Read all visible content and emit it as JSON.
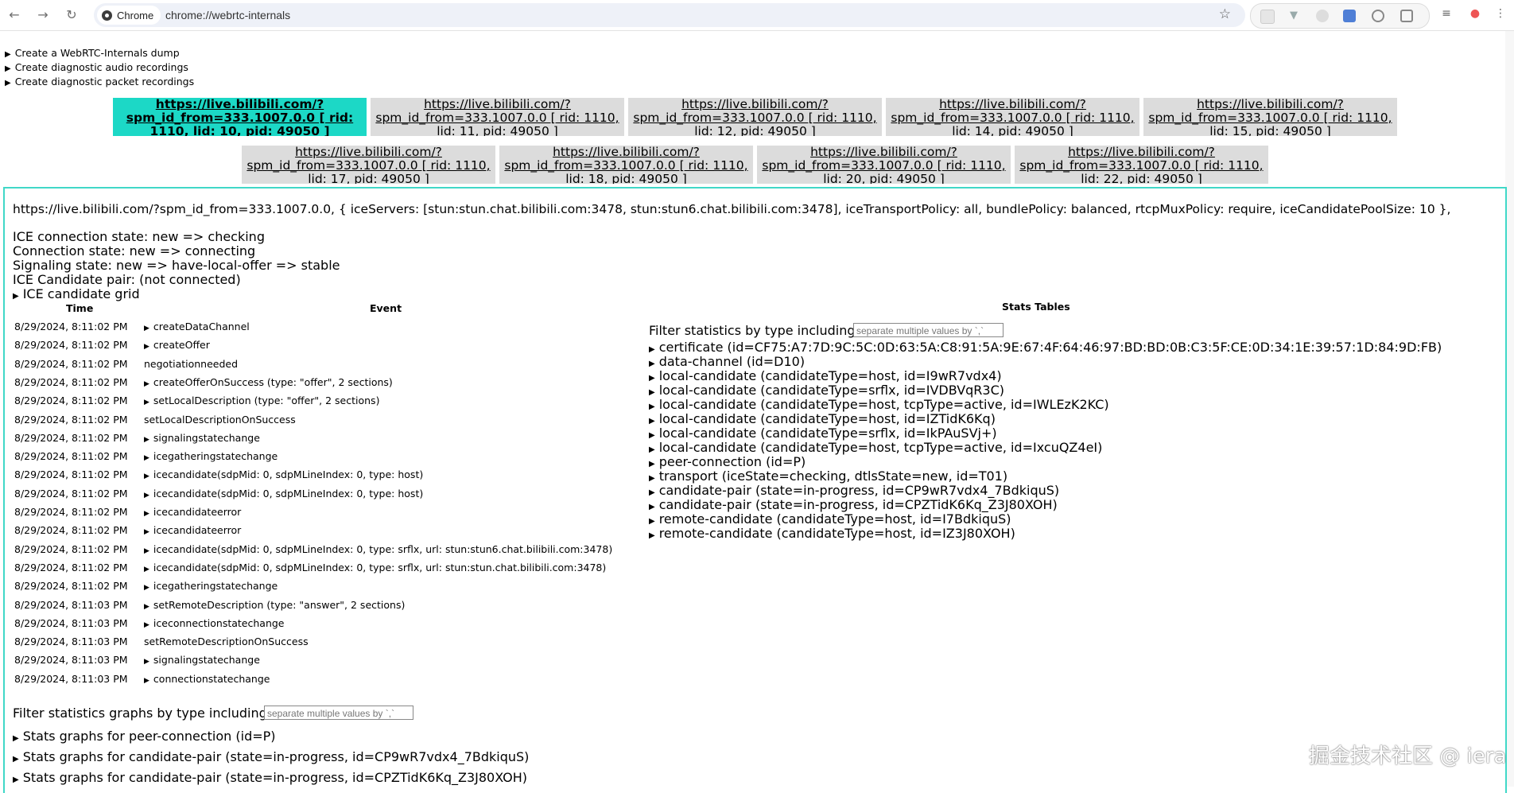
{
  "browser": {
    "site_chip": "Chrome",
    "url": "chrome://webrtc-internals"
  },
  "top_links": [
    "Create a WebRTC-Internals dump",
    "Create diagnostic audio recordings",
    "Create diagnostic packet recordings"
  ],
  "tabs": [
    {
      "line1": "https://live.bilibili.com/?",
      "line2": "spm_id_from=333.1007.0.0 [ rid:",
      "line3": "1110, lid: 10, pid: 49050 ]"
    },
    {
      "line1": "https://live.bilibili.com/?",
      "line2": "spm_id_from=333.1007.0.0 [ rid: 1110,",
      "line3": "lid: 11, pid: 49050 ]"
    },
    {
      "line1": "https://live.bilibili.com/?",
      "line2": "spm_id_from=333.1007.0.0 [ rid: 1110,",
      "line3": "lid: 12, pid: 49050 ]"
    },
    {
      "line1": "https://live.bilibili.com/?",
      "line2": "spm_id_from=333.1007.0.0 [ rid: 1110,",
      "line3": "lid: 14, pid: 49050 ]"
    },
    {
      "line1": "https://live.bilibili.com/?",
      "line2": "spm_id_from=333.1007.0.0 [ rid: 1110,",
      "line3": "lid: 15, pid: 49050 ]"
    },
    {
      "line1": "https://live.bilibili.com/?",
      "line2": "spm_id_from=333.1007.0.0 [ rid: 1110,",
      "line3": "lid: 17, pid: 49050 ]"
    },
    {
      "line1": "https://live.bilibili.com/?",
      "line2": "spm_id_from=333.1007.0.0 [ rid: 1110,",
      "line3": "lid: 18, pid: 49050 ]"
    },
    {
      "line1": "https://live.bilibili.com/?",
      "line2": "spm_id_from=333.1007.0.0 [ rid: 1110,",
      "line3": "lid: 20, pid: 49050 ]"
    },
    {
      "line1": "https://live.bilibili.com/?",
      "line2": "spm_id_from=333.1007.0.0 [ rid: 1110,",
      "line3": "lid: 22, pid: 49050 ]"
    }
  ],
  "connection": {
    "config": "https://live.bilibili.com/?spm_id_from=333.1007.0.0, { iceServers: [stun:stun.chat.bilibili.com:3478, stun:stun6.chat.bilibili.com:3478], iceTransportPolicy: all, bundlePolicy: balanced, rtcpMuxPolicy: require, iceCandidatePoolSize: 10 },",
    "ice_state": "ICE connection state: new => checking",
    "conn_state": "Connection state: new => connecting",
    "signaling_state": "Signaling state: new => have-local-offer => stable",
    "candidate_pair": "ICE Candidate pair: (not connected)",
    "candidate_grid": "ICE candidate grid"
  },
  "event_table": {
    "time_header": "Time",
    "event_header": "Event",
    "rows": [
      {
        "time": "8/29/2024, 8:11:02 PM",
        "event": "createDataChannel",
        "expandable": true
      },
      {
        "time": "8/29/2024, 8:11:02 PM",
        "event": "createOffer",
        "expandable": true
      },
      {
        "time": "8/29/2024, 8:11:02 PM",
        "event": "negotiationneeded",
        "expandable": false
      },
      {
        "time": "8/29/2024, 8:11:02 PM",
        "event": "createOfferOnSuccess (type: \"offer\", 2 sections)",
        "expandable": true
      },
      {
        "time": "8/29/2024, 8:11:02 PM",
        "event": "setLocalDescription (type: \"offer\", 2 sections)",
        "expandable": true
      },
      {
        "time": "8/29/2024, 8:11:02 PM",
        "event": "setLocalDescriptionOnSuccess",
        "expandable": false
      },
      {
        "time": "8/29/2024, 8:11:02 PM",
        "event": "signalingstatechange",
        "expandable": true
      },
      {
        "time": "8/29/2024, 8:11:02 PM",
        "event": "icegatheringstatechange",
        "expandable": true
      },
      {
        "time": "8/29/2024, 8:11:02 PM",
        "event": "icecandidate(sdpMid: 0, sdpMLineIndex: 0, type: host)",
        "expandable": true
      },
      {
        "time": "8/29/2024, 8:11:02 PM",
        "event": "icecandidate(sdpMid: 0, sdpMLineIndex: 0, type: host)",
        "expandable": true
      },
      {
        "time": "8/29/2024, 8:11:02 PM",
        "event": "icecandidateerror",
        "expandable": true
      },
      {
        "time": "8/29/2024, 8:11:02 PM",
        "event": "icecandidateerror",
        "expandable": true
      },
      {
        "time": "8/29/2024, 8:11:02 PM",
        "event": "icecandidate(sdpMid: 0, sdpMLineIndex: 0, type: srflx, url: stun:stun6.chat.bilibili.com:3478)",
        "expandable": true
      },
      {
        "time": "8/29/2024, 8:11:02 PM",
        "event": "icecandidate(sdpMid: 0, sdpMLineIndex: 0, type: srflx, url: stun:stun.chat.bilibili.com:3478)",
        "expandable": true
      },
      {
        "time": "8/29/2024, 8:11:02 PM",
        "event": "icegatheringstatechange",
        "expandable": true
      },
      {
        "time": "8/29/2024, 8:11:03 PM",
        "event": "setRemoteDescription (type: \"answer\", 2 sections)",
        "expandable": true
      },
      {
        "time": "8/29/2024, 8:11:03 PM",
        "event": "iceconnectionstatechange",
        "expandable": true
      },
      {
        "time": "8/29/2024, 8:11:03 PM",
        "event": "setRemoteDescriptionOnSuccess",
        "expandable": false
      },
      {
        "time": "8/29/2024, 8:11:03 PM",
        "event": "signalingstatechange",
        "expandable": true
      },
      {
        "time": "8/29/2024, 8:11:03 PM",
        "event": "connectionstatechange",
        "expandable": true
      }
    ]
  },
  "stats_tables": {
    "header": "Stats Tables",
    "filter_label": "Filter statistics by type including",
    "filter_placeholder": "separate multiple values by `,`",
    "rows": [
      "certificate (id=CF75:A7:7D:9C:5C:0D:63:5A:C8:91:5A:9E:67:4F:64:46:97:BD:BD:0B:C3:5F:CE:0D:34:1E:39:57:1D:84:9D:FB)",
      "data-channel (id=D10)",
      "local-candidate (candidateType=host, id=I9wR7vdx4)",
      "local-candidate (candidateType=srflx, id=IVDBVqR3C)",
      "local-candidate (candidateType=host, tcpType=active, id=IWLEzK2KC)",
      "local-candidate (candidateType=host, id=IZTidK6Kq)",
      "local-candidate (candidateType=srflx, id=IkPAuSVj+)",
      "local-candidate (candidateType=host, tcpType=active, id=IxcuQZ4eI)",
      "peer-connection (id=P)",
      "transport (iceState=checking, dtlsState=new, id=T01)",
      "candidate-pair (state=in-progress, id=CP9wR7vdx4_7BdkiquS)",
      "candidate-pair (state=in-progress, id=CPZTidK6Kq_Z3J80XOH)",
      "remote-candidate (candidateType=host, id=I7BdkiquS)",
      "remote-candidate (candidateType=host, id=IZ3J80XOH)"
    ]
  },
  "graphs": {
    "filter_label": "Filter statistics graphs by type including",
    "filter_placeholder": "separate multiple values by `,`",
    "rows": [
      "Stats graphs for peer-connection (id=P)",
      "Stats graphs for candidate-pair (state=in-progress, id=CP9wR7vdx4_7BdkiquS)",
      "Stats graphs for candidate-pair (state=in-progress, id=CPZTidK6Kq_Z3J80XOH)"
    ]
  },
  "watermark": "掘金技术社区 @ iera"
}
